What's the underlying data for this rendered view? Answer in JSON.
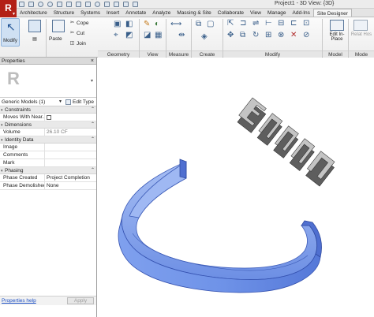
{
  "app": {
    "logo": "R",
    "window_title": "Project1 - 3D View: {3D}"
  },
  "ribbon": {
    "tabs": [
      "Architecture",
      "Structure",
      "Systems",
      "Insert",
      "Annotate",
      "Analyze",
      "Massing & Site",
      "Collaborate",
      "View",
      "Manage",
      "Add-Ins",
      "Site Designer"
    ],
    "modify_label": "Modify",
    "clipboard": {
      "cope": "Cope",
      "cut": "Cut",
      "join": "Join",
      "paste": "Paste"
    },
    "panels": {
      "geometry": "Geometry",
      "view": "View",
      "measure": "Measure",
      "create": "Create",
      "modify": "Modify",
      "model": "Model",
      "mode": "Mode"
    },
    "edit_in_place": "Edit In-Place",
    "related_hosts": "Relat Hos"
  },
  "properties": {
    "title": "Properties",
    "close": "×",
    "family": "Generic Models (1)",
    "edit_type": "Edit Type",
    "groups": [
      {
        "name": "Constraints",
        "rows": [
          {
            "key": "Moves With Near...",
            "value": "",
            "checkbox": true
          }
        ]
      },
      {
        "name": "Dimensions",
        "rows": [
          {
            "key": "Volume",
            "value": "26.10 CF",
            "dim": true
          }
        ]
      },
      {
        "name": "Identity Data",
        "rows": [
          {
            "key": "Image",
            "value": ""
          },
          {
            "key": "Comments",
            "value": ""
          },
          {
            "key": "Mark",
            "value": ""
          }
        ]
      },
      {
        "name": "Phasing",
        "rows": [
          {
            "key": "Phase Created",
            "value": "Project Completion"
          },
          {
            "key": "Phase Demolished",
            "value": "None"
          }
        ]
      }
    ],
    "help_link": "Properties help",
    "apply": "Apply"
  },
  "colors": {
    "ring_face": "#6f93e8",
    "ring_dark": "#4f6fd0",
    "ring_light": "#9fb8f3",
    "text3d_face": "#bdbdbd",
    "text3d_side": "#5e5e5e"
  }
}
